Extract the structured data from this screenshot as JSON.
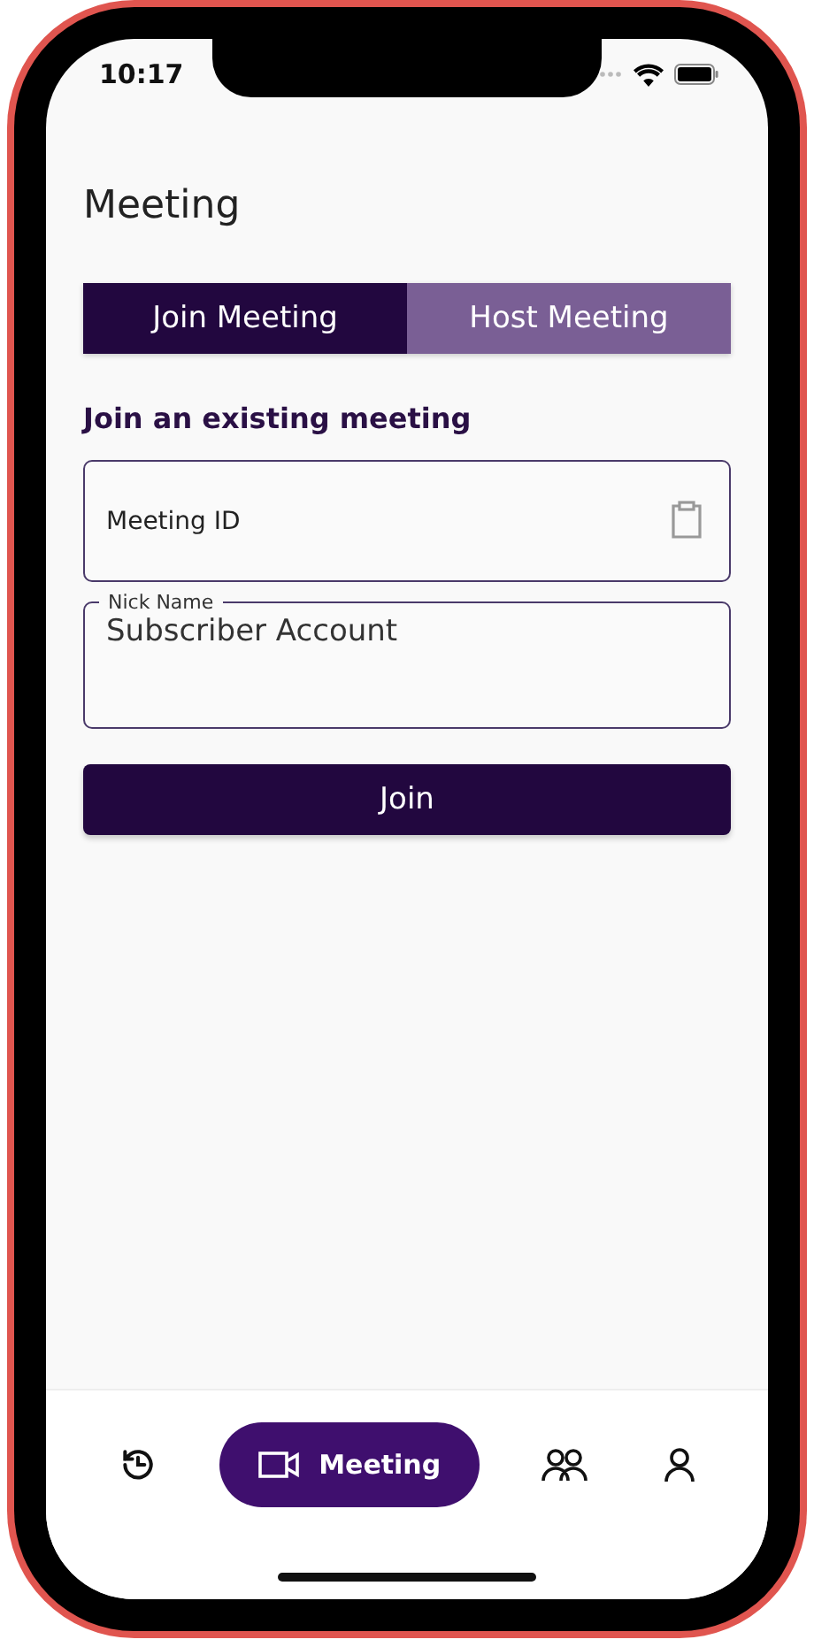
{
  "status_bar": {
    "time": "10:17"
  },
  "title": "Meeting",
  "tabs": [
    {
      "label": "Join Meeting",
      "selected": true
    },
    {
      "label": "Host Meeting",
      "selected": false
    }
  ],
  "section_heading": "Join an existing meeting",
  "fields": [
    {
      "kind": "placeholder",
      "placeholder": "Meeting ID"
    },
    {
      "kind": "labeled",
      "label": "Nick Name",
      "value": "Subscriber Account"
    }
  ],
  "join_button": "Join",
  "bottom_nav": [
    {
      "selected": false
    },
    {
      "selected": true,
      "label": "Meeting"
    },
    {
      "selected": false
    },
    {
      "selected": false
    }
  ]
}
